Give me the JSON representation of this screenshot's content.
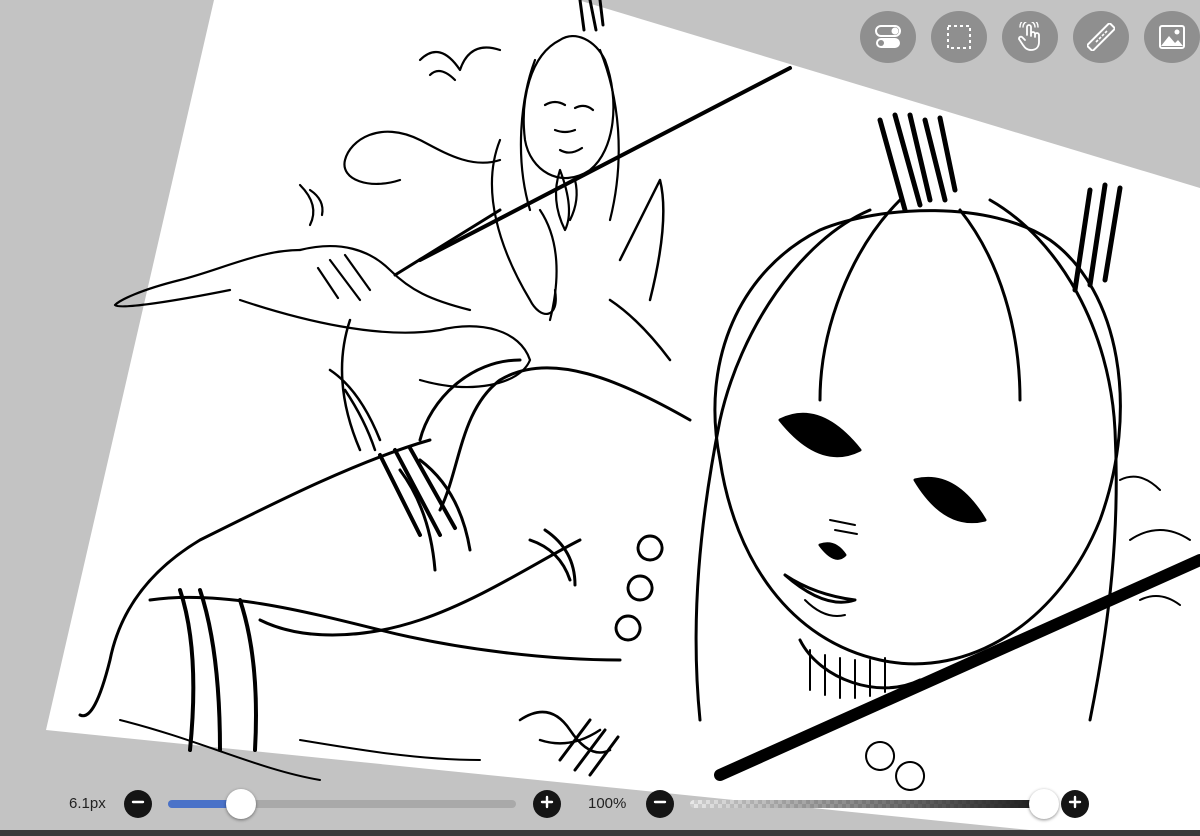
{
  "toolbar": {
    "buttons": [
      {
        "name": "toggle-icon"
      },
      {
        "name": "selection-icon"
      },
      {
        "name": "touch-gesture-icon"
      },
      {
        "name": "ruler-icon"
      },
      {
        "name": "image-icon"
      }
    ],
    "button_color": "#8f8f8f"
  },
  "canvas": {
    "paper_color": "#ffffff",
    "background_color": "#c3c3c3",
    "content": "sketch-artwork"
  },
  "brush_size": {
    "label": "6.1px",
    "value_fraction": 0.21,
    "fill_color": "#4a72c8",
    "track_color": "#a9a9a9"
  },
  "opacity": {
    "label": "100%",
    "value_fraction": 1.0,
    "fill_color": "#1a1a1a"
  },
  "controls": {
    "minus_icon": "minus-icon",
    "plus_icon": "plus-icon"
  }
}
